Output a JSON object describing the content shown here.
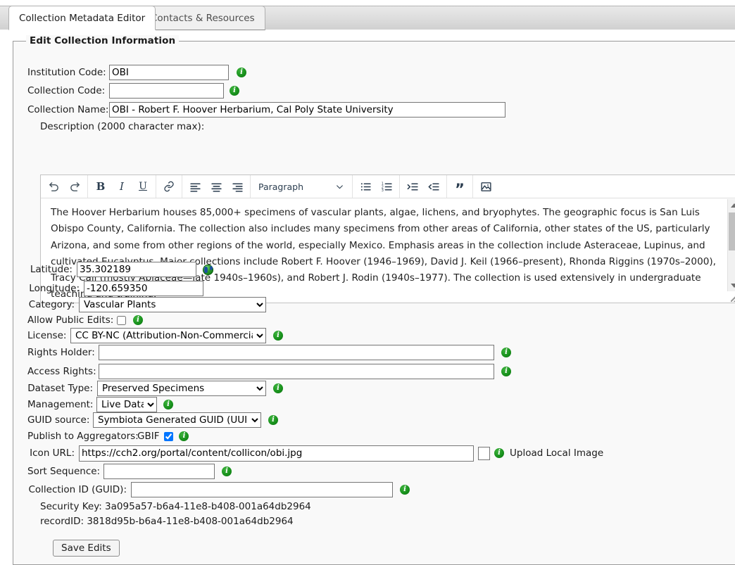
{
  "tabs": [
    {
      "label": "Collection Metadata Editor",
      "active": true
    },
    {
      "label": "Contacts & Resources",
      "active": false
    }
  ],
  "fieldset": {
    "legend": "Edit Collection Information"
  },
  "fields": {
    "institution_code": {
      "label": "Institution Code:",
      "value": "OBI",
      "placeholder": ""
    },
    "collection_code": {
      "label": "Collection Code:",
      "value": "",
      "placeholder": ""
    },
    "collection_name": {
      "label": "Collection Name:",
      "value": "OBI - Robert F. Hoover Herbarium, Cal Poly State University",
      "placeholder": ""
    },
    "description": {
      "label": "Description (2000 character max):"
    },
    "latitude": {
      "label": "Latitude:",
      "value": "35.302189",
      "placeholder": ""
    },
    "longitude": {
      "label": "Longitude:",
      "value": "-120.659350",
      "placeholder": ""
    },
    "category": {
      "label": "Category:",
      "value": "Vascular Plants",
      "options": [
        "Vascular Plants"
      ]
    },
    "allow_public_edits": {
      "label": "Allow Public Edits:",
      "checked": false
    },
    "license": {
      "label": "License:",
      "value": "CC BY-NC (Attribution-Non-Commercial)",
      "options": [
        "CC BY-NC (Attribution-Non-Commercial)"
      ]
    },
    "rights_holder": {
      "label": "Rights Holder:",
      "value": "",
      "placeholder": ""
    },
    "access_rights": {
      "label": "Access Rights:",
      "value": "",
      "placeholder": ""
    },
    "dataset_type": {
      "label": "Dataset Type:",
      "value": "Preserved Specimens",
      "options": [
        "Preserved Specimens"
      ]
    },
    "management": {
      "label": "Management:",
      "value": "Live Data",
      "options": [
        "Live Data"
      ]
    },
    "guid_source": {
      "label": "GUID source:",
      "value": "Symbiota Generated GUID (UUID)",
      "options": [
        "Symbiota Generated GUID (UUID)"
      ]
    },
    "publish_aggregators": {
      "label": "Publish to Aggregators:",
      "gbif_label": "GBIF",
      "gbif_checked": true
    },
    "icon_url": {
      "label": "Icon URL:",
      "value": "https://cch2.org/portal/content/collicon/obi.jpg",
      "placeholder": "",
      "upload_label": "Upload Local Image"
    },
    "sort_sequence": {
      "label": "Sort Sequence:",
      "value": "",
      "placeholder": ""
    },
    "collection_id": {
      "label": "Collection ID (GUID):",
      "value": "",
      "placeholder": ""
    }
  },
  "editor": {
    "toolbar": {
      "undo": "undo-icon",
      "redo": "redo-icon",
      "bold": "B",
      "italic": "I",
      "underline": "U",
      "link": "link-icon",
      "align_left": "align-left-icon",
      "align_center": "align-center-icon",
      "align_right": "align-right-icon",
      "format_value": "Paragraph",
      "format_options": [
        "Paragraph"
      ],
      "bullet_list": "bullet-list-icon",
      "numbered_list": "numbered-list-icon",
      "indent": "indent-icon",
      "outdent": "outdent-icon",
      "blockquote": "”",
      "image": "image-icon"
    },
    "body_text": "The Hoover Herbarium houses 85,000+ specimens of vascular plants, algae, lichens, and bryophytes. The geographic focus is San Luis Obispo County, California. The collection also includes many specimens from other areas of California, other states of the US, particularly Arizona, and some from other regions of the world, especially Mexico. Emphasis areas in the collection include Asteraceae, Lupinus, and cultivated Eucalyptus. Major collections include Robert F. Hoover (1946–1969), David J. Keil (1966–present), Rhonda Riggins (1970s–2000), Tracy Call (mostly Apiaceae—late 1940s–1960s), and Robert J. Rodin (1940s–1977). The collection is used extensively in undergraduate teaching and training."
  },
  "readonly": {
    "security_key": "Security Key: 3a095a57-b6a4-11e8-b408-001a64db2964",
    "record_id": "recordID: 3818d95b-b6a4-11e8-b408-001a64db2964"
  },
  "actions": {
    "save": "Save Edits"
  },
  "colors": {
    "info_green": "#17901b",
    "checkbox_blue": "#1a73e8",
    "tab_active_bg": "#ffffff",
    "panel_bg": "#f9f9f9"
  }
}
